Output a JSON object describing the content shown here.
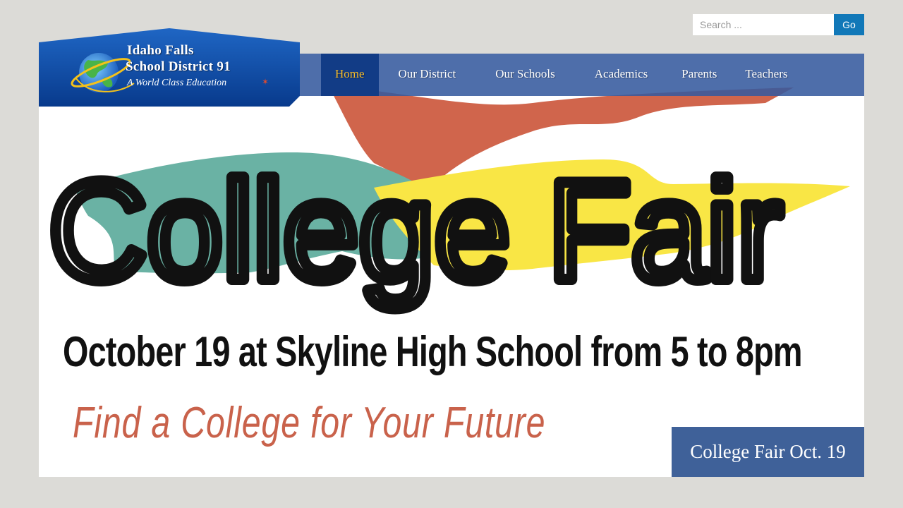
{
  "search": {
    "placeholder": "Search ...",
    "button_label": "Go"
  },
  "logo": {
    "line1": "Idaho Falls",
    "line2": "School District 91",
    "tagline": "A World Class Education"
  },
  "nav": {
    "items": [
      {
        "label": "Home",
        "active": true
      },
      {
        "label": "Our District"
      },
      {
        "label": "Our Schools"
      },
      {
        "label": "Academics"
      },
      {
        "label": "Parents"
      },
      {
        "label": "Teachers"
      }
    ]
  },
  "banner": {
    "headline": "College Fair",
    "date_line": "October 19 at Skyline High School from 5 to 8pm",
    "tagline": "Find a College for Your Future"
  },
  "slide_caption": "College Fair Oct. 19",
  "colors": {
    "background": "#dcdbd7",
    "nav_bar": "#355a9e",
    "nav_active": "#123c86",
    "nav_active_text": "#f4ba2c",
    "search_button": "#1178b8",
    "caption": "#3f6199",
    "teal_swoosh": "#6ab2a4",
    "yellow_swoosh": "#f9e645",
    "red_swoosh": "#d0654c",
    "tagline_red": "#c9624b"
  }
}
